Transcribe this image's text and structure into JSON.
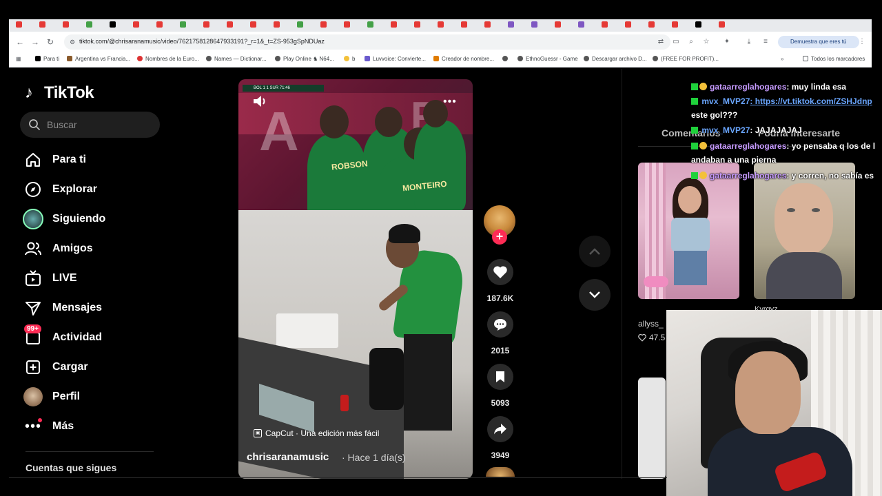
{
  "browser": {
    "url": "tiktok.com/@chrisaranamusic/video/7621758128647933191?_r=1&_t=ZS-953gSpNDUaz",
    "verify_label": "Demuestra que eres tú",
    "bookmarks": [
      "Para ti",
      "Argentina vs Francia...",
      "Nombres de la Euro...",
      "Names — Dictionar...",
      "Play Online ♞ N64...",
      "b",
      "Luvvoice: Convierte...",
      "Creador de nombre...",
      "EthnoGuessr - Game",
      "Descargar archivo D...",
      "(FREE FOR PROFIT)...",
      "Todos los marcadores"
    ]
  },
  "sidebar": {
    "logo": "TikTok",
    "search_placeholder": "Buscar",
    "items": [
      {
        "label": "Para ti",
        "icon": "home-icon"
      },
      {
        "label": "Explorar",
        "icon": "compass-icon"
      },
      {
        "label": "Siguiendo",
        "icon": "following-avatar"
      },
      {
        "label": "Amigos",
        "icon": "friends-icon"
      },
      {
        "label": "LIVE",
        "icon": "live-tv-icon"
      },
      {
        "label": "Mensajes",
        "icon": "messages-icon"
      },
      {
        "label": "Actividad",
        "icon": "activity-icon",
        "badge": "99+"
      },
      {
        "label": "Cargar",
        "icon": "upload-icon"
      },
      {
        "label": "Perfil",
        "icon": "profile-avatar"
      },
      {
        "label": "Más",
        "icon": "more-dots-icon"
      }
    ],
    "following_title": "Cuentas que sigues"
  },
  "video": {
    "scoreboard": "BOL 1  1 SUR  71:46",
    "jersey_1": "ROBSON",
    "jersey_2": "MONTEIRO",
    "capcut_label": "CapCut · Una edición más fácil",
    "author": "chrisaranamusic",
    "time": "· Hace 1 día(s)"
  },
  "actions": {
    "likes": "187.6K",
    "comments": "2015",
    "saves": "5093",
    "shares": "3949"
  },
  "right_panel": {
    "tab_comments": "Comentarios",
    "tab_interest": "Podría interesarte",
    "thumb_author": "allyss_",
    "thumb_likes": "47.5",
    "thumb2_overlay": "Kyrgyz"
  },
  "chat": [
    {
      "user": "gataarreglahogares",
      "text": ": muy linda esa"
    },
    {
      "user": "mvx_MVP27",
      "text": ": https://vt.tiktok.com/ZSHJdnp"
    },
    {
      "user": "",
      "text": "este gol???"
    },
    {
      "user": "mvx_MVP27",
      "text": ": JAJAJAJAJ"
    },
    {
      "user": "gataarreglahogares",
      "text": ": yo pensaba q los de l"
    },
    {
      "user": "",
      "text": "andaban a una pierna"
    },
    {
      "user": "gataarreglahogares",
      "text": ": y corren, no sabía es"
    }
  ],
  "colors": {
    "accent": "#fe2c55",
    "chat_pink": "#c79bff",
    "chat_blue": "#6aa6ff"
  }
}
